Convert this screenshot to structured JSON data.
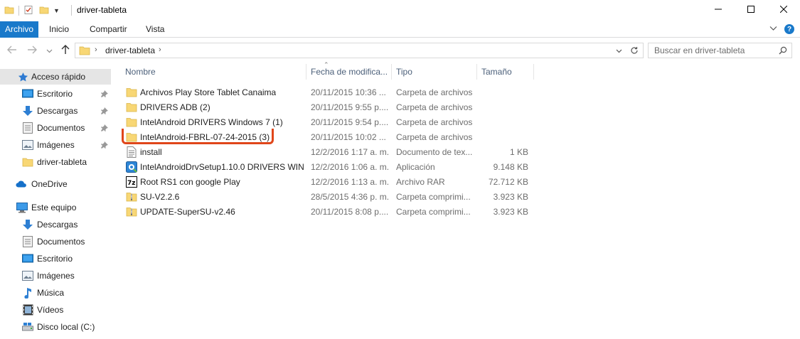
{
  "window": {
    "title": "driver-tableta"
  },
  "ribbon": {
    "tabs": [
      {
        "label": "Archivo",
        "active": true
      },
      {
        "label": "Inicio",
        "active": false
      },
      {
        "label": "Compartir",
        "active": false
      },
      {
        "label": "Vista",
        "active": false
      }
    ],
    "help": "?"
  },
  "address": {
    "crumb": "driver-tableta"
  },
  "search": {
    "placeholder": "Buscar en driver-tableta"
  },
  "nav": {
    "items": [
      {
        "label": "Acceso rápido",
        "icon": "star-icon"
      },
      {
        "label": "Escritorio",
        "icon": "desktop-icon"
      },
      {
        "label": "Descargas",
        "icon": "download-icon"
      },
      {
        "label": "Documentos",
        "icon": "documents-icon"
      },
      {
        "label": "Imágenes",
        "icon": "pictures-icon"
      },
      {
        "label": "driver-tableta",
        "icon": "folder-icon"
      },
      {
        "label": "OneDrive",
        "icon": "cloud-icon"
      },
      {
        "label": "Este equipo",
        "icon": "computer-icon"
      },
      {
        "label": "Descargas",
        "icon": "download-icon"
      },
      {
        "label": "Documentos",
        "icon": "documents-icon"
      },
      {
        "label": "Escritorio",
        "icon": "desktop-icon"
      },
      {
        "label": "Imágenes",
        "icon": "pictures-icon"
      },
      {
        "label": "Música",
        "icon": "music-icon"
      },
      {
        "label": "Vídeos",
        "icon": "videos-icon"
      },
      {
        "label": "Disco local (C:)",
        "icon": "drive-icon"
      }
    ]
  },
  "columns": {
    "name": "Nombre",
    "date": "Fecha de modifica...",
    "type": "Tipo",
    "size": "Tamaño"
  },
  "files": [
    {
      "name": "Archivos Play Store Tablet Canaima",
      "date": "20/11/2015 10:36 ...",
      "type": "Carpeta de archivos",
      "size": "",
      "icon": "folder-icon"
    },
    {
      "name": "DRIVERS ADB (2)",
      "date": "20/11/2015 9:55 p....",
      "type": "Carpeta de archivos",
      "size": "",
      "icon": "folder-icon"
    },
    {
      "name": "IntelAndroid DRIVERS Windows 7 (1)",
      "date": "20/11/2015 9:54 p....",
      "type": "Carpeta de archivos",
      "size": "",
      "icon": "folder-icon"
    },
    {
      "name": "IntelAndroid-FBRL-07-24-2015 (3)",
      "date": "20/11/2015 10:02 ...",
      "type": "Carpeta de archivos",
      "size": "",
      "icon": "folder-icon"
    },
    {
      "name": "install",
      "date": "12/2/2016 1:17 a. m.",
      "type": "Documento de tex...",
      "size": "1 KB",
      "icon": "text-file-icon"
    },
    {
      "name": "IntelAndroidDrvSetup1.10.0 DRIVERS WIN...",
      "date": "12/2/2016 1:06 a. m.",
      "type": "Aplicación",
      "size": "9.148 KB",
      "icon": "setup-app-icon"
    },
    {
      "name": "Root RS1 con google Play",
      "date": "12/2/2016 1:13 a. m.",
      "type": "Archivo RAR",
      "size": "72.712 KB",
      "icon": "archive-icon"
    },
    {
      "name": "SU-V2.2.6",
      "date": "28/5/2015 4:36 p. m.",
      "type": "Carpeta comprimi...",
      "size": "3.923 KB",
      "icon": "zip-folder-icon"
    },
    {
      "name": "UPDATE-SuperSU-v2.46",
      "date": "20/11/2015 8:08 p....",
      "type": "Carpeta comprimi...",
      "size": "3.923 KB",
      "icon": "zip-folder-icon"
    }
  ],
  "colors": {
    "accent": "#1979ca",
    "highlight": "#e0461a",
    "folder": "#f8d775"
  }
}
